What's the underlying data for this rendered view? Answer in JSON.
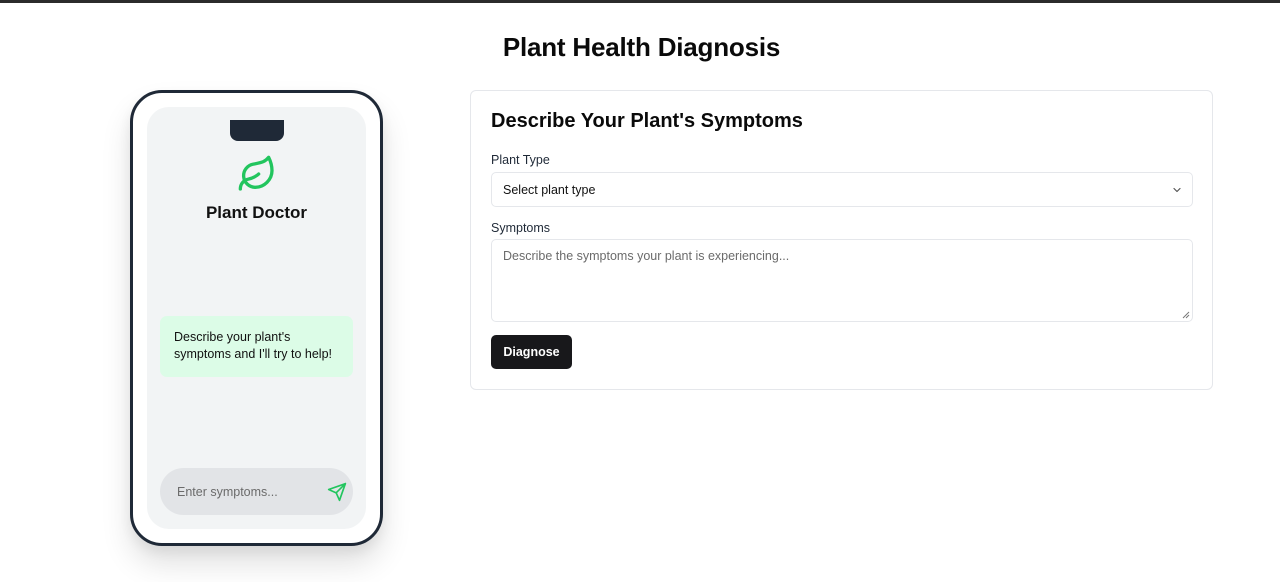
{
  "page": {
    "title": "Plant Health Diagnosis"
  },
  "phone": {
    "app_name": "Plant Doctor",
    "logo_icon": "leaf-icon",
    "bot_message": "Describe your plant's symptoms and I'll try to help!",
    "input_placeholder": "Enter symptoms...",
    "send_icon": "send-icon"
  },
  "form": {
    "title": "Describe Your Plant's Symptoms",
    "plant_type_label": "Plant Type",
    "plant_type_value": "Select plant type",
    "symptoms_label": "Symptoms",
    "symptoms_placeholder": "Describe the symptoms your plant is experiencing...",
    "diagnose_label": "Diagnose"
  },
  "colors": {
    "accent_green": "#22c55e",
    "bubble_bg": "#dcfce7",
    "button_bg": "#18181b",
    "phone_frame": "#1f2937"
  }
}
